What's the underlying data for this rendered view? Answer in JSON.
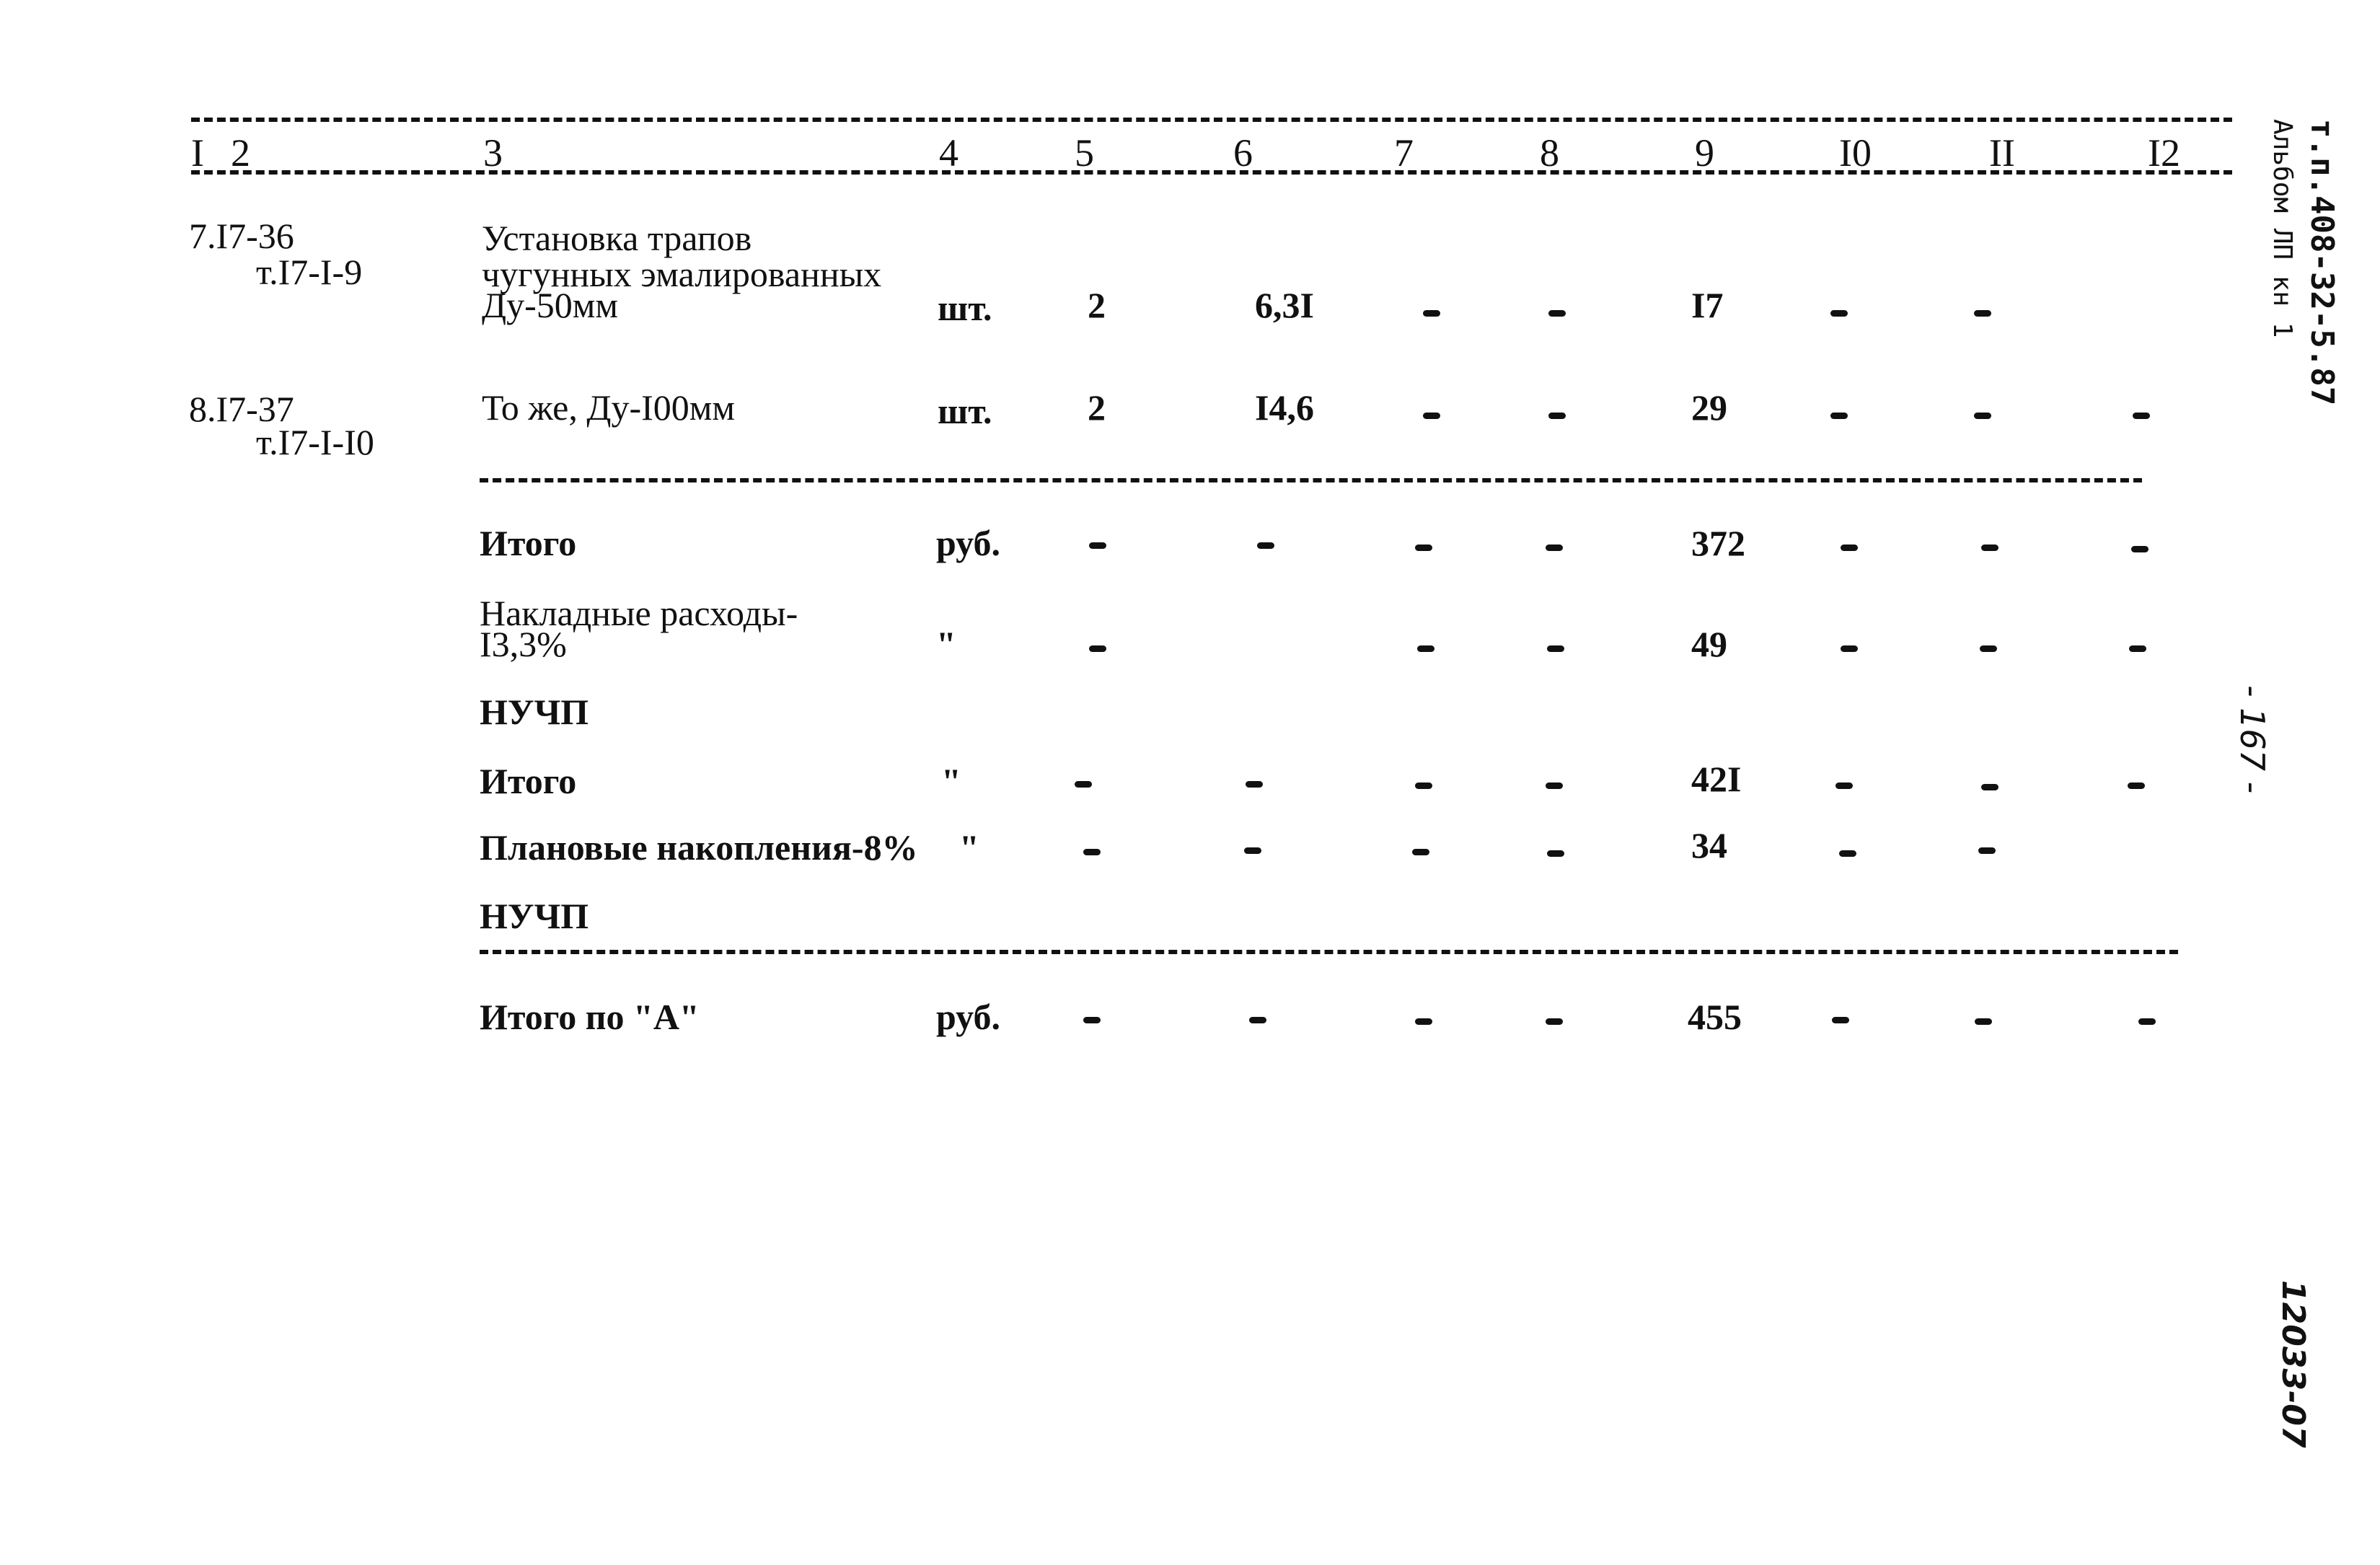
{
  "header": {
    "columns": [
      "I",
      "2",
      "3",
      "4",
      "5",
      "6",
      "7",
      "8",
      "9",
      "I0",
      "II",
      "I2"
    ]
  },
  "rows": [
    {
      "code": "7.I7-36",
      "ref": "т.I7-I-9",
      "name_lines": [
        "Установка трапов",
        "чугунных эмалированных",
        "Ду-50мм"
      ],
      "unit": "шт.",
      "c5": "2",
      "c6": "6,3I",
      "c7": "-",
      "c8": "-",
      "c9": "I7",
      "c10": "-",
      "c11": "-",
      "c12": ""
    },
    {
      "code": "8.I7-37",
      "ref": "т.I7-I-I0",
      "name_lines": [
        "То же, Ду-I00мм"
      ],
      "unit": "шт.",
      "c5": "2",
      "c6": "I4,6",
      "c7": "-",
      "c8": "-",
      "c9": "29",
      "c10": "-",
      "c11": "-",
      "c12": "-"
    }
  ],
  "totals": [
    {
      "name": "Итого",
      "unit": "руб.",
      "c5": "-",
      "c6": "-",
      "c7": "-",
      "c8": "-",
      "c9": "372",
      "c10": "-",
      "c11": "-",
      "c12": "-"
    },
    {
      "name_lines": [
        "Накладные расходы-",
        "I3,3%"
      ],
      "unit": "\"",
      "c5": "-",
      "c6": "",
      "c7": "-",
      "c8": "-",
      "c9": "49",
      "c10": "-",
      "c11": "-",
      "c12": "-"
    },
    {
      "name": "НУЧП"
    },
    {
      "name": "Итого",
      "unit": "\"",
      "c5": "-",
      "c6": "-",
      "c7": "-",
      "c8": "-",
      "c9": "42I",
      "c10": "-",
      "c11": "-",
      "c12": "-"
    },
    {
      "name": "Плановые накопления-8%",
      "unit": "\"",
      "c5": "-",
      "c6": "-",
      "c7": "-",
      "c8": "-",
      "c9": "34",
      "c10": "-",
      "c11": "-",
      "c12": ""
    },
    {
      "name": "НУЧП"
    }
  ],
  "grand_total": {
    "name": "Итого по \"А\"",
    "unit": "руб.",
    "c5": "-",
    "c6": "-",
    "c7": "-",
    "c8": "-",
    "c9": "455",
    "c10": "-",
    "c11": "-",
    "c12": "-"
  },
  "margin": {
    "doc_code": "т.п.408-32-5.87",
    "album": "Альбом ЛП кн 1",
    "page_number": "- 167 -",
    "archive_number": "12033-07"
  }
}
